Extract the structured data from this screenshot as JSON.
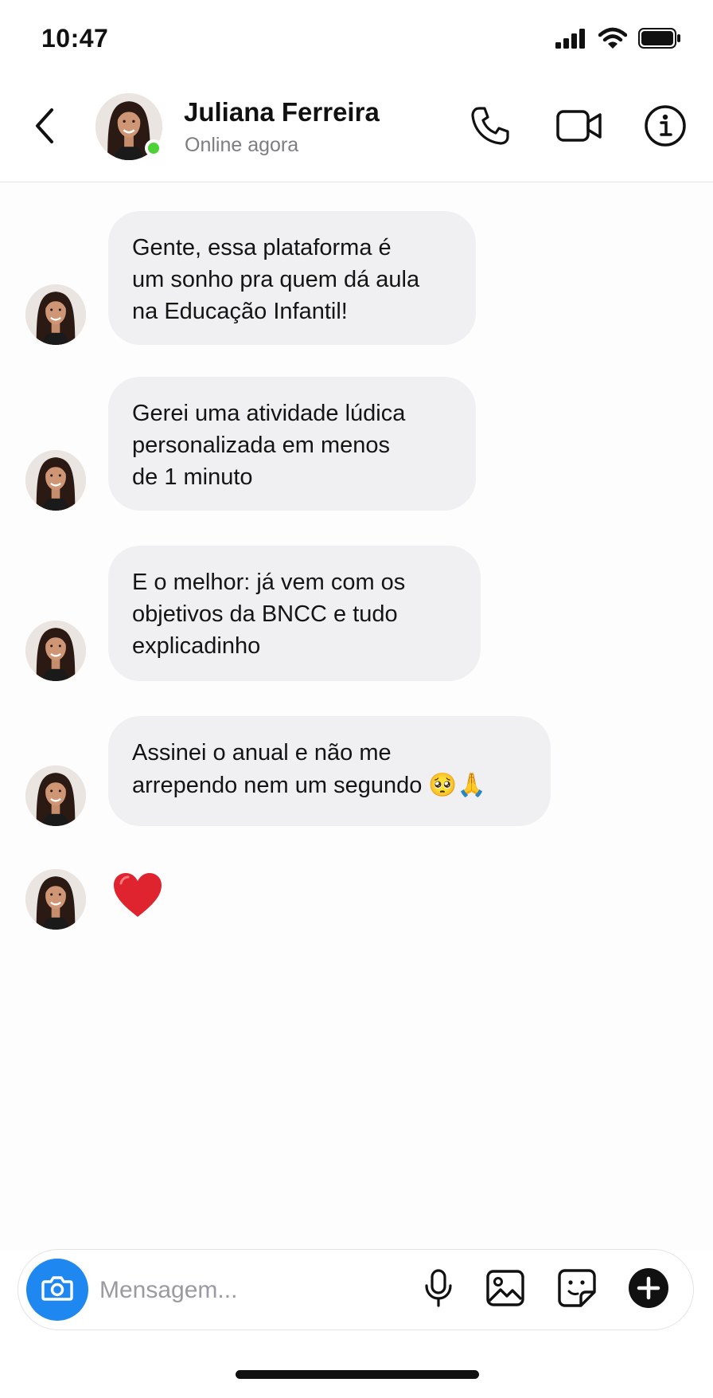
{
  "status_bar": {
    "time": "10:47"
  },
  "header": {
    "contact_name": "Juliana Ferreira",
    "contact_status": "Online agora",
    "icons": [
      "chevron-left-icon",
      "phone-icon",
      "video-camera-icon",
      "info-icon"
    ]
  },
  "messages": [
    {
      "text": "Gente, essa plataforma é um sonho pra quem dá aula na Educação Infantil!",
      "lines": [
        "Gente, essa plataforma é",
        "um sonho pra quem dá aula",
        "na Educação Infantil!"
      ]
    },
    {
      "text": "Gerei uma atividade lúdica personalizada em menos de 1 minuto",
      "lines": [
        "Gerei uma atividade lúdica",
        "personalizada em menos",
        "de 1 minuto"
      ]
    },
    {
      "text": "E o melhor: já vem com os objetivos da BNCC e tudo explicadinho",
      "lines": [
        "E o melhor: já vem com os",
        "objetivos da BNCC e tudo",
        "explicadinho"
      ]
    },
    {
      "text": "Assinei o anual e não me arrependo nem um segundo 🥺🙏",
      "lines": [
        "Assinei o anual e não me",
        "arrependo nem um segundo"
      ],
      "emoji": "🥺🙏"
    },
    {
      "reaction": "❤️"
    }
  ],
  "composer": {
    "placeholder": "Mensagem...",
    "icons": [
      "camera-icon",
      "microphone-icon",
      "image-icon",
      "sticker-icon",
      "plus-icon"
    ]
  },
  "colors": {
    "bubble_bg": "#f0f0f2",
    "camera_button": "#1e88f0",
    "online_dot": "#4cd137",
    "heart": "#e0242f"
  }
}
